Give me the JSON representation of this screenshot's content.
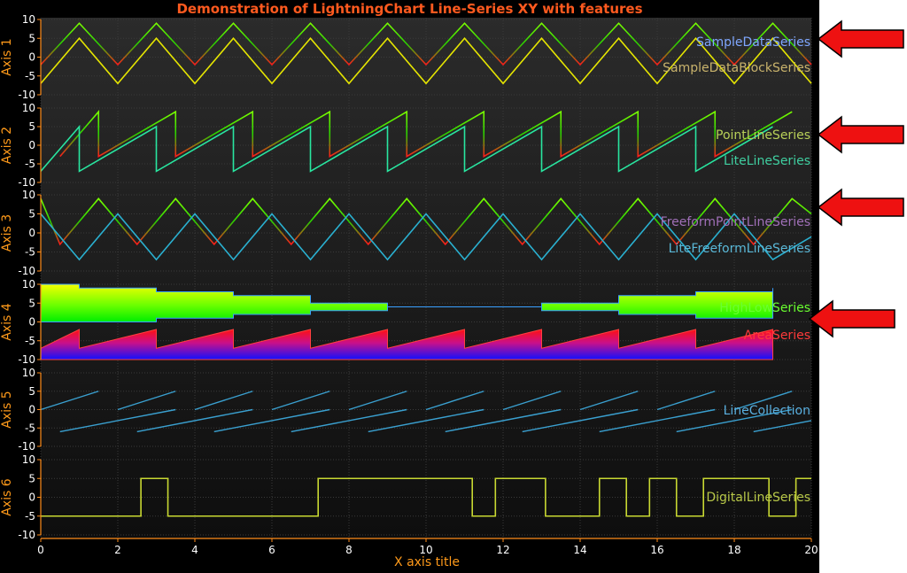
{
  "chart_data": {
    "type": "line",
    "title": "Demonstration of LightningChart Line-Series XY with features",
    "xlabel": "X axis title",
    "xlim": [
      0,
      20
    ],
    "x_ticks": [
      "0",
      "2",
      "4",
      "6",
      "8",
      "10",
      "12",
      "14",
      "16",
      "18",
      "20"
    ],
    "y_ticks": [
      "10",
      "5",
      "0",
      "-5",
      "-10"
    ],
    "grid": true,
    "axes": [
      {
        "label": "Axis 1",
        "ylim": [
          -10,
          10
        ],
        "series": [
          {
            "name": "SampleDataSeries",
            "style": "gradient-green-red",
            "x": [
              0,
              1,
              2,
              3,
              4,
              5,
              6,
              7,
              8,
              9,
              10,
              11,
              12,
              13,
              14,
              15,
              16,
              17,
              18,
              19,
              20
            ],
            "y": [
              -2,
              9,
              -2,
              9,
              -2,
              9,
              -2,
              9,
              -2,
              9,
              -2,
              9,
              -2,
              9,
              -2,
              9,
              -2,
              9,
              -2,
              9,
              -2
            ]
          },
          {
            "name": "SampleDataBlockSeries",
            "color": "#e6e600",
            "x": [
              0,
              1,
              2,
              3,
              4,
              5,
              6,
              7,
              8,
              9,
              10,
              11,
              12,
              13,
              14,
              15,
              16,
              17,
              18,
              19,
              20
            ],
            "y": [
              -7,
              5,
              -7,
              5,
              -7,
              5,
              -7,
              5,
              -7,
              5,
              -7,
              5,
              -7,
              5,
              -7,
              5,
              -7,
              5,
              -7,
              5,
              -7
            ]
          }
        ]
      },
      {
        "label": "Axis 2",
        "ylim": [
          -10,
          10
        ],
        "series": [
          {
            "name": "PointLineSeries",
            "style": "gradient-green-red",
            "x": [
              0.5,
              1.5,
              1.5,
              3.5,
              3.5,
              5.5,
              5.5,
              7.5,
              7.5,
              9.5,
              9.5,
              11.5,
              11.5,
              13.5,
              13.5,
              15.5,
              15.5,
              17.5,
              17.5,
              19.5
            ],
            "y": [
              -3,
              9,
              -3,
              9,
              -3,
              9,
              -3,
              9,
              -3,
              9,
              -3,
              9,
              -3,
              9,
              -3,
              9,
              -3,
              9,
              -3,
              9
            ]
          },
          {
            "name": "LiteLineSeries",
            "color": "#28e6a0",
            "x": [
              0,
              1,
              1,
              3,
              3,
              5,
              5,
              7,
              7,
              9,
              9,
              11,
              11,
              13,
              13,
              15,
              15,
              17,
              17,
              19
            ],
            "y": [
              -7,
              5,
              -7,
              5,
              -7,
              5,
              -7,
              5,
              -7,
              5,
              -7,
              5,
              -7,
              5,
              -7,
              5,
              -7,
              5,
              -7,
              5
            ]
          }
        ]
      },
      {
        "label": "Axis 3",
        "ylim": [
          -10,
          10
        ],
        "series": [
          {
            "name": "FreeformPointLineSeries",
            "style": "gradient-green-red",
            "x": [
              0,
              0.5,
              1.5,
              2.5,
              3.5,
              4.5,
              5.5,
              6.5,
              7.5,
              8.5,
              9.5,
              10.5,
              11.5,
              12.5,
              13.5,
              14.5,
              15.5,
              16.5,
              17.5,
              18.5,
              19.5,
              20
            ],
            "y": [
              9,
              -3,
              9,
              -3,
              9,
              -3,
              9,
              -3,
              9,
              -3,
              9,
              -3,
              9,
              -3,
              9,
              -3,
              9,
              -3,
              9,
              -3,
              9,
              5
            ]
          },
          {
            "name": "LiteFreeformLineSeries",
            "color": "#2ab0d0",
            "x": [
              0,
              1,
              2,
              3,
              4,
              5,
              6,
              7,
              8,
              9,
              10,
              11,
              12,
              13,
              14,
              15,
              16,
              17,
              18,
              19,
              20
            ],
            "y": [
              5,
              -7,
              5,
              -7,
              5,
              -7,
              5,
              -7,
              5,
              -7,
              5,
              -7,
              5,
              -7,
              5,
              -7,
              5,
              -7,
              5,
              -7,
              -1
            ]
          }
        ]
      },
      {
        "label": "Axis 4",
        "ylim": [
          -10,
          10
        ],
        "series": [
          {
            "name": "HighLowSeries",
            "style": "gradient-yellow-green",
            "x": [
              0,
              1,
              3,
              5,
              7,
              9,
              11,
              13,
              15,
              17,
              19
            ],
            "high": [
              10,
              9,
              8,
              7,
              5,
              4,
              4,
              5,
              7,
              8,
              9
            ],
            "low": [
              0,
              0,
              1,
              2,
              3,
              4,
              4,
              3,
              2,
              1,
              1
            ]
          },
          {
            "name": "AreaSeries",
            "style": "gradient-red-blue",
            "baseline": -10,
            "x": [
              0,
              1,
              1,
              3,
              3,
              5,
              5,
              7,
              7,
              9,
              9,
              11,
              11,
              13,
              13,
              15,
              15,
              17,
              17,
              19
            ],
            "y": [
              -7,
              -2,
              -7,
              -2,
              -7,
              -2,
              -7,
              -2,
              -7,
              -2,
              -7,
              -2,
              -7,
              -2,
              -7,
              -2,
              -7,
              -2,
              -7,
              -2
            ]
          }
        ]
      },
      {
        "label": "Axis 5",
        "ylim": [
          -10,
          10
        ],
        "series": [
          {
            "name": "LineCollection",
            "color": "#3aa0d0",
            "segments": [
              [
                [
                  0,
                  0
                ],
                [
                  1.5,
                  5
                ]
              ],
              [
                [
                  0.5,
                  -6
                ],
                [
                  3.5,
                  0
                ]
              ],
              [
                [
                  2,
                  0
                ],
                [
                  3.5,
                  5
                ]
              ],
              [
                [
                  2.5,
                  -6
                ],
                [
                  5.5,
                  0
                ]
              ],
              [
                [
                  4,
                  0
                ],
                [
                  5.5,
                  5
                ]
              ],
              [
                [
                  4.5,
                  -6
                ],
                [
                  7.5,
                  0
                ]
              ],
              [
                [
                  6,
                  0
                ],
                [
                  7.5,
                  5
                ]
              ],
              [
                [
                  6.5,
                  -6
                ],
                [
                  9.5,
                  0
                ]
              ],
              [
                [
                  8,
                  0
                ],
                [
                  9.5,
                  5
                ]
              ],
              [
                [
                  8.5,
                  -6
                ],
                [
                  11.5,
                  0
                ]
              ],
              [
                [
                  10,
                  0
                ],
                [
                  11.5,
                  5
                ]
              ],
              [
                [
                  10.5,
                  -6
                ],
                [
                  13.5,
                  0
                ]
              ],
              [
                [
                  12,
                  0
                ],
                [
                  13.5,
                  5
                ]
              ],
              [
                [
                  12.5,
                  -6
                ],
                [
                  15.5,
                  0
                ]
              ],
              [
                [
                  14,
                  0
                ],
                [
                  15.5,
                  5
                ]
              ],
              [
                [
                  14.5,
                  -6
                ],
                [
                  17.5,
                  0
                ]
              ],
              [
                [
                  16,
                  0
                ],
                [
                  17.5,
                  5
                ]
              ],
              [
                [
                  16.5,
                  -6
                ],
                [
                  19.5,
                  0
                ]
              ],
              [
                [
                  18,
                  0
                ],
                [
                  19.5,
                  5
                ]
              ],
              [
                [
                  18.5,
                  -6
                ],
                [
                  20,
                  -3
                ]
              ]
            ]
          }
        ]
      },
      {
        "label": "Axis 6",
        "ylim": [
          -10,
          10
        ],
        "series": [
          {
            "name": "DigitalLineSeries",
            "color": "#c8d832",
            "step": true,
            "x": [
              0,
              2.6,
              2.6,
              3.3,
              3.3,
              7.2,
              7.2,
              11.2,
              11.2,
              11.8,
              11.8,
              13.1,
              13.1,
              14.5,
              14.5,
              15.2,
              15.2,
              15.8,
              15.8,
              16.5,
              16.5,
              17.2,
              17.2,
              18.9,
              18.9,
              19.6,
              19.6,
              20
            ],
            "y": [
              -5,
              -5,
              5,
              5,
              -5,
              -5,
              5,
              5,
              -5,
              -5,
              5,
              5,
              -5,
              -5,
              5,
              5,
              -5,
              -5,
              5,
              5,
              -5,
              -5,
              5,
              5,
              -5,
              -5,
              5,
              5
            ]
          }
        ]
      }
    ]
  },
  "arrows": {
    "color": "#ee1111",
    "count": 4
  }
}
